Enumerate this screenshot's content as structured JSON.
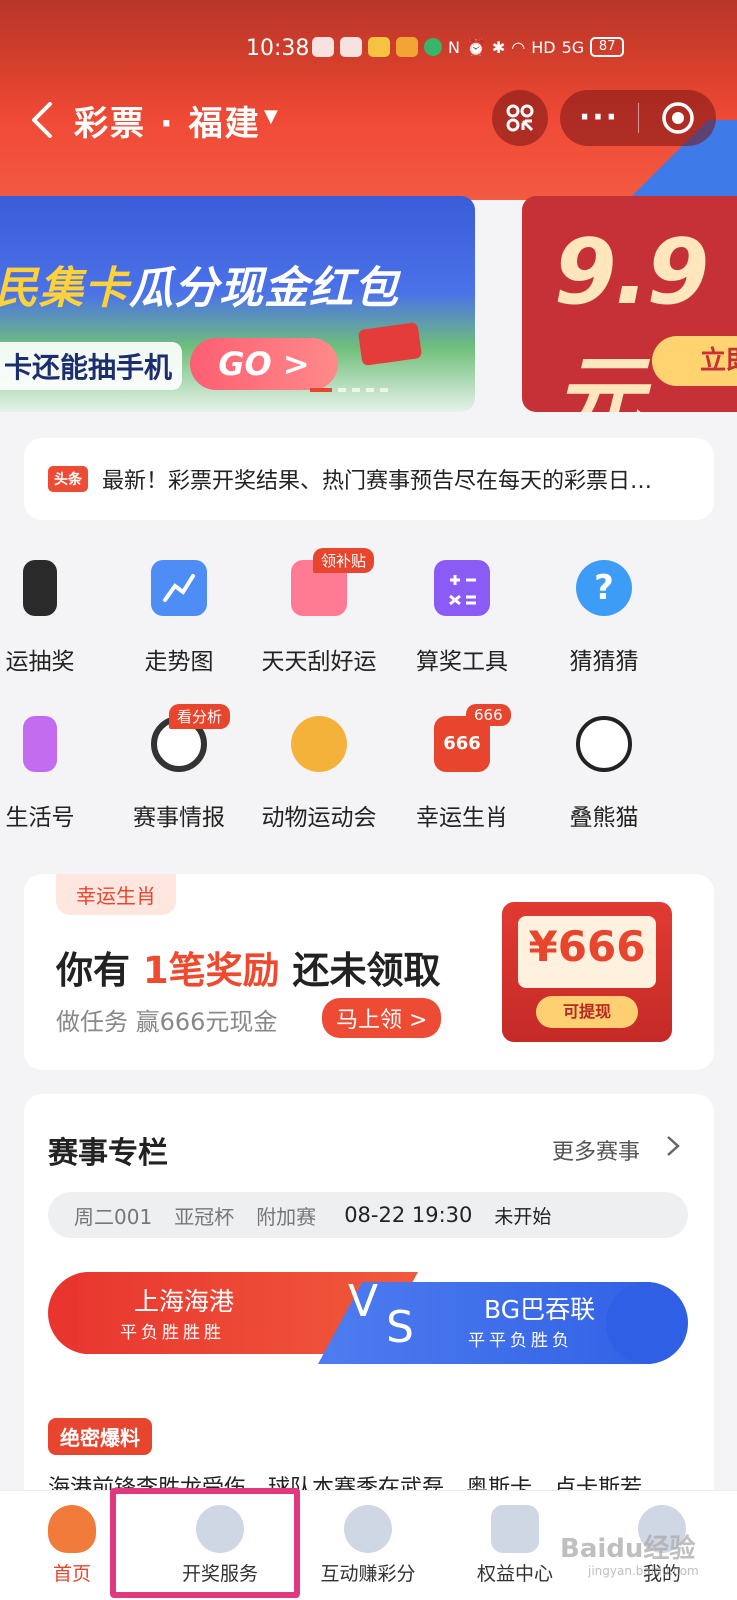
{
  "status_bar": {
    "time": "10:38",
    "network": "HD",
    "signal": "5G",
    "battery": "87"
  },
  "nav": {
    "title": "彩票 · 福建",
    "caret": "▼",
    "more": "···"
  },
  "banners": [
    {
      "headline_white_start": "民集卡",
      "headline_yellow": "瓜分现金红包",
      "sub": "卡还能抽手机",
      "button": "GO >"
    },
    {
      "price": "9.9元",
      "button": "立即"
    }
  ],
  "notice": {
    "tag": "头条",
    "text": "最新！彩票开奖结果、热门赛事预告尽在每天的彩票日…"
  },
  "grid_row1": [
    {
      "label": "运抽奖",
      "icon": "phone-icon",
      "color": "#2a2a2a"
    },
    {
      "label": "走势图",
      "icon": "trend-chart-icon",
      "color": "#4d8df5"
    },
    {
      "label": "天天刮好运",
      "icon": "ticket-icon",
      "color": "#ff7a93",
      "badge": "领补贴"
    },
    {
      "label": "算奖工具",
      "icon": "calculator-icon",
      "color": "#8a5cf5"
    },
    {
      "label": "猜猜猜",
      "icon": "question-icon",
      "color": "#3d9cf5"
    }
  ],
  "grid_row2": [
    {
      "label": "生活号",
      "icon": "heart-card-icon",
      "color": "#c36cf0"
    },
    {
      "label": "赛事情报",
      "icon": "soccer-ball-icon",
      "color": "#333333",
      "badge": "看分析"
    },
    {
      "label": "动物运动会",
      "icon": "medal-icon",
      "color": "#f5b23a"
    },
    {
      "label": "幸运生肖",
      "icon": "lucky-666-icon",
      "color": "#e8452f",
      "badge": "666"
    },
    {
      "label": "叠熊猫",
      "icon": "panda-icon",
      "color": "#ffffff"
    }
  ],
  "reward": {
    "chip": "幸运生肖",
    "headline_before": "你有 ",
    "headline_red": "1笔奖励",
    "headline_after": " 还未领取",
    "sub": "做任务 赢666元现金",
    "claim_button": "马上领 >",
    "amount": "¥666",
    "withdraw": "可提现"
  },
  "match": {
    "title": "赛事专栏",
    "more": "更多赛事",
    "info": {
      "code": "周二001",
      "league": "亚冠杯",
      "stage": "附加赛",
      "datetime": "08-22 19:30",
      "status": "未开始"
    },
    "home": {
      "name": "上海海港",
      "form": "平负胜胜胜"
    },
    "away": {
      "name": "BG巴吞联",
      "form": "平平负胜负"
    },
    "vs_v": "V",
    "vs_s": "S",
    "hot_tag": "绝密爆料",
    "hot_text": "海港前锋李胜龙受伤，球队本赛季在武磊、奥斯卡、卢卡斯若"
  },
  "tabbar": [
    {
      "label": "首页",
      "icon": "home-mascot-icon",
      "active": true
    },
    {
      "label": "开奖服务",
      "icon": "lottery-ball-icon",
      "active": false
    },
    {
      "label": "互动赚彩分",
      "icon": "planet-icon",
      "active": false
    },
    {
      "label": "权益中心",
      "icon": "clover-icon",
      "active": false
    },
    {
      "label": "我的",
      "icon": "user-icon",
      "active": false
    }
  ],
  "watermark": {
    "brand": "Baidu经验",
    "url": "jingyan.baidu.com"
  },
  "colors": {
    "brand_red": "#e8452f",
    "highlight": "#e0397f",
    "blue": "#2f5fe4"
  }
}
